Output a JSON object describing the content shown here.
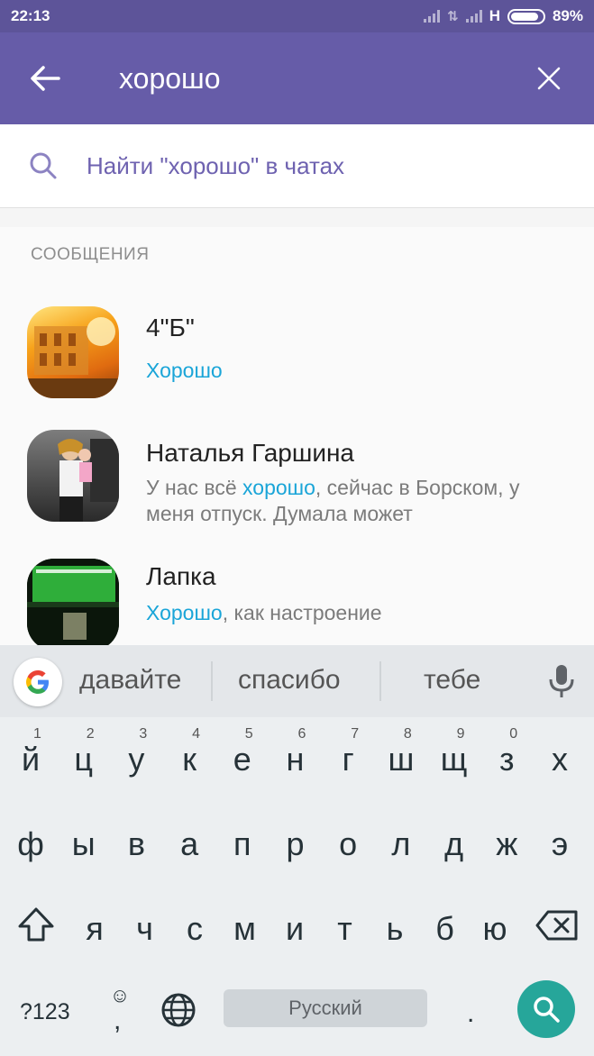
{
  "status_bar": {
    "time": "22:13",
    "network": "H",
    "battery": "89%",
    "battery_level": 0.89
  },
  "toolbar": {
    "query": "хорошо",
    "back_icon": "arrow-left-icon",
    "close_icon": "close-icon"
  },
  "find_in_chats": {
    "label": "Найти \"хорошо\" в чатах",
    "icon": "search-icon"
  },
  "messages_section": {
    "title": "СООБЩЕНИЯ",
    "items": [
      {
        "name": "4\"Б\"",
        "parts": [
          {
            "text": "Хорошо",
            "highlight": true
          }
        ]
      },
      {
        "name": "Наталья Гаршина",
        "parts": [
          {
            "text": "У нас всё ",
            "highlight": false
          },
          {
            "text": "хорошо",
            "highlight": true
          },
          {
            "text": ", сейчас в Борском, у меня отпуск. Думала может",
            "highlight": false
          }
        ]
      },
      {
        "name": "Лапка",
        "parts": [
          {
            "text": "Хорошо",
            "highlight": true
          },
          {
            "text": ", как настроение",
            "highlight": false
          }
        ]
      }
    ]
  },
  "keyboard": {
    "suggestions": [
      "давайте",
      "спасибо",
      "тебе"
    ],
    "row1": [
      "й",
      "ц",
      "у",
      "к",
      "е",
      "н",
      "г",
      "ш",
      "щ",
      "з",
      "х"
    ],
    "row1_numbers": [
      "1",
      "2",
      "3",
      "4",
      "5",
      "6",
      "7",
      "8",
      "9",
      "0",
      ""
    ],
    "row2": [
      "ф",
      "ы",
      "в",
      "а",
      "п",
      "р",
      "о",
      "л",
      "д",
      "ж",
      "э"
    ],
    "row3": [
      "я",
      "ч",
      "с",
      "м",
      "и",
      "т",
      "ь",
      "б",
      "ю"
    ],
    "symbols_label": "?123",
    "emoji_label": "☺",
    "comma_label": ",",
    "space_label": "Русский",
    "period_label": ".",
    "accent_color": "#26a69a"
  },
  "colors": {
    "toolbar": "#665ca8",
    "statusbar": "#5d5499",
    "highlight": "#1aa5d8",
    "find_text": "#6e62b0"
  }
}
